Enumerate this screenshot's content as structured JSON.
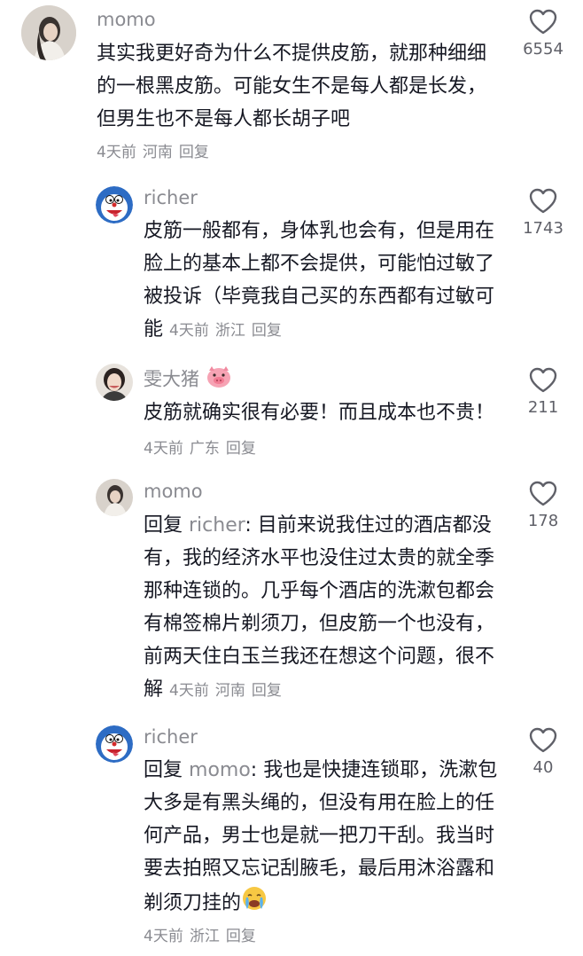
{
  "comments": [
    {
      "username": "momo",
      "text": "其实我更好奇为什么不提供皮筋，就那种细细的一根黑皮筋。可能女生不是每人都是长发，但男生也不是每人都长胡子吧",
      "time": "4天前",
      "location": "河南",
      "reply_label": "回复",
      "likes": "6554"
    },
    {
      "username": "richer",
      "text": "皮筋一般都有，身体乳也会有，但是用在脸上的基本上都不会提供，可能怕过敏了被投诉（毕竟我自己买的东西都有过敏可能",
      "time": "4天前",
      "location": "浙江",
      "reply_label": "回复",
      "likes": "1743"
    },
    {
      "username": "雯大猪",
      "text": "皮筋就确实很有必要！而且成本也不贵！",
      "time": "4天前",
      "location": "广东",
      "reply_label": "回复",
      "likes": "211"
    },
    {
      "username": "momo",
      "reply_prefix": "回复",
      "reply_target": "richer",
      "text": ": 目前来说我住过的酒店都没有，我的经济水平也没住过太贵的就全季那种连锁的。几乎每个酒店的洗漱包都会有棉签棉片剃须刀，但皮筋一个也没有，前两天住白玉兰我还在想这个问题，很不解",
      "time": "4天前",
      "location": "河南",
      "reply_label": "回复",
      "likes": "178"
    },
    {
      "username": "richer",
      "reply_prefix": "回复",
      "reply_target": "momo",
      "text": ": 我也是快捷连锁耶，洗漱包大多是有黑头绳的，但没有用在脸上的任何产品，男士也是就一把刀干刮。我当时要去拍照又忘记刮腋毛，最后用沐浴露和剃须刀挂的",
      "time": "4天前",
      "location": "浙江",
      "reply_label": "回复",
      "likes": "40"
    }
  ],
  "icons": {
    "like": "heart-outline-icon",
    "pig": "pig-face-emoji-icon",
    "cry": "crying-face-emoji-icon"
  },
  "colors": {
    "text": "#161823",
    "muted": "#8a8b91",
    "count": "#5f6068"
  }
}
